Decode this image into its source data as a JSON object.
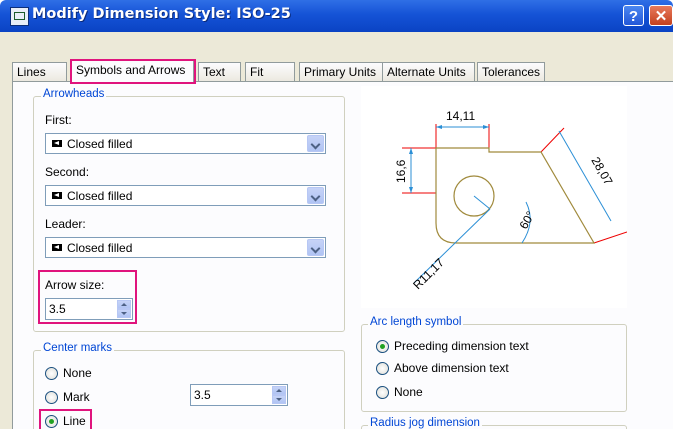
{
  "window": {
    "title": "Modify Dimension Style: ISO-25",
    "help_label": "?",
    "close_label": "✕"
  },
  "tabs": [
    "Lines",
    "Symbols and Arrows",
    "Text",
    "Fit",
    "Primary Units",
    "Alternate Units",
    "Tolerances"
  ],
  "arrowheads": {
    "legend": "Arrowheads",
    "first_label": "First:",
    "first_value": "Closed filled",
    "second_label": "Second:",
    "second_value": "Closed filled",
    "leader_label": "Leader:",
    "leader_value": "Closed filled",
    "arrow_size_label": "Arrow size:",
    "arrow_size_value": "3.5"
  },
  "center_marks": {
    "legend": "Center marks",
    "options": [
      "None",
      "Mark",
      "Line"
    ],
    "selected": "Line",
    "size_value": "3.5"
  },
  "arc_length_symbol": {
    "legend": "Arc length symbol",
    "options": [
      "Preceding dimension text",
      "Above dimension text",
      "None"
    ],
    "selected": "Preceding dimension text"
  },
  "radius_jog": {
    "legend": "Radius jog dimension"
  },
  "preview": {
    "dim_top": "14,11",
    "dim_left": "16,6",
    "dim_angle": "60°",
    "dim_slant": "28,07",
    "dim_radius": "R11,17"
  },
  "colors": {
    "highlight": "#e0147d",
    "legend_text": "#0046d5",
    "titlebar": "#1553d6"
  }
}
